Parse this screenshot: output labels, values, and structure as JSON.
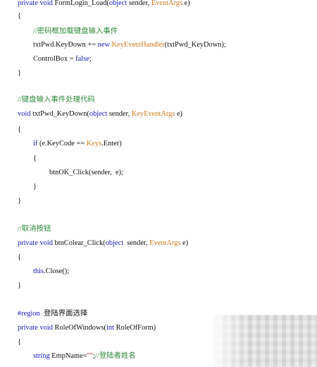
{
  "code_lines": [
    [
      {
        "t": "private void ",
        "c": "kw"
      },
      {
        "t": "FormLogin_Load(",
        "c": "pl"
      },
      {
        "t": "object",
        "c": "kw"
      },
      {
        "t": " sender, ",
        "c": "pl"
      },
      {
        "t": "EventArgs",
        "c": "ty"
      },
      {
        "t": " e)",
        "c": "pl"
      }
    ],
    [
      {
        "t": "{",
        "c": "pl"
      }
    ],
    [
      {
        "t": "//密码框加载键盘输入事件",
        "c": "cm"
      }
    ],
    [
      {
        "t": "txtPwd.KeyDown += ",
        "c": "pl"
      },
      {
        "t": "new ",
        "c": "kw"
      },
      {
        "t": "KeyEventHandler",
        "c": "ty"
      },
      {
        "t": "(txtPwd_KeyDown);",
        "c": "pl"
      }
    ],
    [
      {
        "t": "ControlBox = ",
        "c": "pl"
      },
      {
        "t": "false",
        "c": "kw"
      },
      {
        "t": ";",
        "c": "pl"
      }
    ],
    [
      {
        "t": "}",
        "c": "pl"
      }
    ],
    [
      {
        "t": "//键盘输入事件处理代码",
        "c": "cm"
      }
    ],
    [
      {
        "t": "void ",
        "c": "kw"
      },
      {
        "t": "txtPwd_KeyDown(",
        "c": "pl"
      },
      {
        "t": "object",
        "c": "kw"
      },
      {
        "t": " sender, ",
        "c": "pl"
      },
      {
        "t": "KeyEventArgs",
        "c": "ty"
      },
      {
        "t": " e)",
        "c": "pl"
      }
    ],
    [
      {
        "t": "{",
        "c": "pl"
      }
    ],
    [
      {
        "t": "if",
        "c": "kw"
      },
      {
        "t": " (e.KeyCode == ",
        "c": "pl"
      },
      {
        "t": "Keys",
        "c": "ty"
      },
      {
        "t": ".Enter)",
        "c": "pl"
      }
    ],
    [
      {
        "t": "{",
        "c": "pl"
      }
    ],
    [
      {
        "t": "btnOK_Click(sender,  e);",
        "c": "pl"
      }
    ],
    [
      {
        "t": "}",
        "c": "pl"
      }
    ],
    [
      {
        "t": "}",
        "c": "pl"
      }
    ],
    [
      {
        "t": "//取消按钮",
        "c": "cm"
      }
    ],
    [
      {
        "t": "private void ",
        "c": "kw"
      },
      {
        "t": "btnColear_Click(",
        "c": "pl"
      },
      {
        "t": "object",
        "c": "kw"
      },
      {
        "t": "  sender, ",
        "c": "pl"
      },
      {
        "t": "EventArgs",
        "c": "ty"
      },
      {
        "t": " e)",
        "c": "pl"
      }
    ],
    [
      {
        "t": "{",
        "c": "pl"
      }
    ],
    [
      {
        "t": "this",
        "c": "kw"
      },
      {
        "t": ".Close();",
        "c": "pl"
      }
    ],
    [
      {
        "t": "}",
        "c": "pl"
      }
    ],
    [
      {
        "t": "#region",
        "c": "rg"
      },
      {
        "t": "  登陆界面选择",
        "c": "pl"
      }
    ],
    [
      {
        "t": "private void ",
        "c": "kw"
      },
      {
        "t": "RoleOfWindows(",
        "c": "pl"
      },
      {
        "t": "int",
        "c": "kw"
      },
      {
        "t": " RoleOfForm)",
        "c": "pl"
      }
    ],
    [
      {
        "t": "{",
        "c": "pl"
      }
    ],
    [
      {
        "t": "string",
        "c": "kw"
      },
      {
        "t": " EmpName=",
        "c": "pl"
      },
      {
        "t": "\"\"",
        "c": "st"
      },
      {
        "t": ";",
        "c": "pl"
      },
      {
        "t": "//登陆者姓名",
        "c": "cm"
      }
    ]
  ]
}
